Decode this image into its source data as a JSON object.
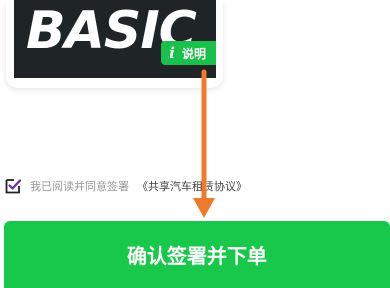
{
  "banner": {
    "title": "BASIC",
    "explain_button": {
      "icon": "info-icon",
      "icon_glyph": "i",
      "label": "说明"
    }
  },
  "agreement": {
    "checkbox_icon": "checkbox-checked-icon",
    "checked": true,
    "text": "我已阅读并同意签署",
    "contract_link": "《共享汽车租赁协议》"
  },
  "confirm_button": {
    "label": "确认签署并下单",
    "color": "#18c84a"
  },
  "annotation": {
    "arrow_icon": "arrow-down-icon",
    "color": "#f07a2c"
  }
}
